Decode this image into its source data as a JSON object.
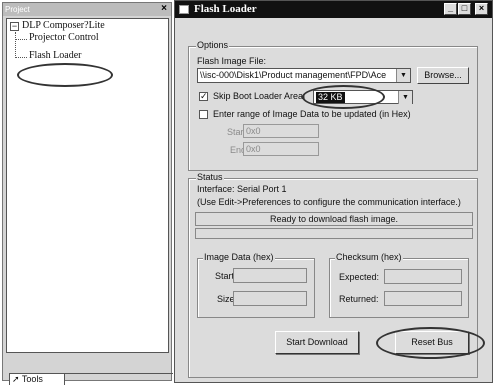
{
  "project_pane": {
    "title": "Project",
    "close_glyph": "×",
    "tree": {
      "expander": "−",
      "root": "DLP Composer?Lite",
      "children": [
        "Projector Control",
        "Flash Loader"
      ]
    },
    "tools_tab": "Tools"
  },
  "window": {
    "title": "Flash Loader",
    "controls": {
      "minimize": "_",
      "maximize": "□",
      "close": "×"
    }
  },
  "options": {
    "legend": "Options",
    "flash_image_label": "Flash Image File:",
    "file_path": "\\\\isc-000\\Disk1\\Product management\\FPD\\Ace",
    "browse_label": "Browse...",
    "skip_boot_loader": {
      "checked": true,
      "mark": "✓",
      "label": "Skip Boot Loader Area(",
      "value": "32 KB"
    },
    "enter_range": {
      "checked": false,
      "label": "Enter range of Image Data to be updated (in Hex)"
    },
    "start_label": "Start:",
    "start_value": "0x0",
    "end_label": "End:",
    "end_value": "0x0"
  },
  "status": {
    "legend": "Status",
    "interface": "Interface:  Serial Port 1",
    "preferences_hint": "(Use Edit->Preferences to configure the communication interface.)",
    "message": "Ready to download flash image.",
    "progress": 0,
    "image_data": {
      "legend": "Image Data (hex)",
      "start_label": "Start:",
      "size_label": "Size:"
    },
    "checksum": {
      "legend": "Checksum (hex)",
      "expected_label": "Expected:",
      "returned_label": "Returned:"
    }
  },
  "buttons": {
    "start_download": "Start Download",
    "reset_bus": "Reset Bus"
  }
}
